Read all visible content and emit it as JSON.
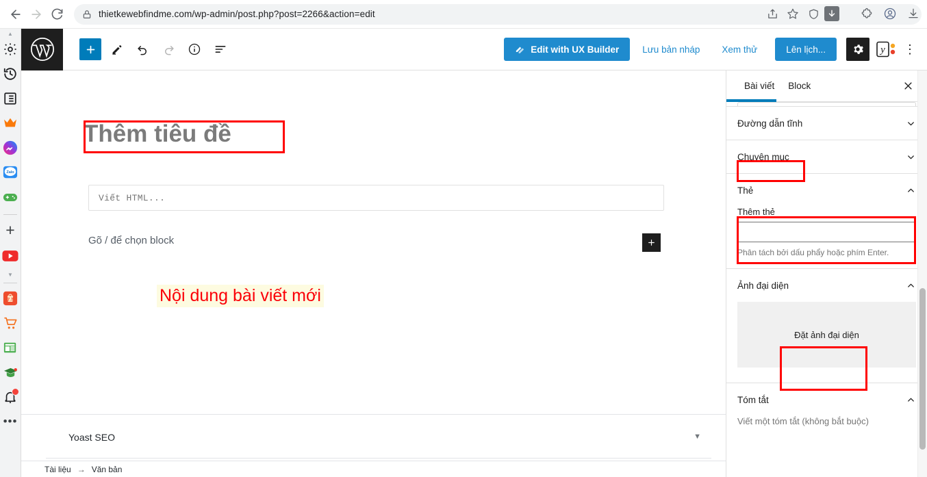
{
  "browser": {
    "url": "thietkewebfindme.com/wp-admin/post.php?post=2266&action=edit",
    "nav": {
      "back": "back-arrow",
      "forward": "forward-arrow",
      "reload": "reload"
    },
    "omnibox_icons": [
      "share-icon",
      "bookmark-star-icon",
      "shield-icon",
      "download-arrow-icon"
    ],
    "extension_icons": [
      "puzzle-extensions-icon",
      "profile-avatar-icon",
      "downloads-icon"
    ]
  },
  "left_rail": {
    "items": [
      {
        "name": "collapse-caret",
        "glyph": "caret"
      },
      {
        "name": "settings-gear-icon",
        "glyph": "gear"
      },
      {
        "name": "history-icon",
        "glyph": "history"
      },
      {
        "name": "list-icon",
        "glyph": "list"
      },
      {
        "name": "crown-icon",
        "glyph": "crown"
      },
      {
        "name": "messenger-icon",
        "glyph": "messenger"
      },
      {
        "name": "zalo-icon",
        "glyph": "zalo",
        "label": "Zalo"
      },
      {
        "name": "gamepad-icon",
        "glyph": "gamepad"
      },
      {
        "name": "add-app-icon",
        "glyph": "plus"
      },
      {
        "name": "youtube-icon",
        "glyph": "youtube"
      },
      {
        "name": "more-caret",
        "glyph": "caret-down"
      },
      {
        "name": "shopee-icon",
        "glyph": "shopee",
        "label": "7.7"
      },
      {
        "name": "cart-icon",
        "glyph": "cart"
      },
      {
        "name": "news-icon",
        "glyph": "news"
      },
      {
        "name": "graduation-icon",
        "glyph": "graduation"
      },
      {
        "name": "notification-bell-icon",
        "glyph": "bell",
        "badge": true
      },
      {
        "name": "overflow-menu-icon",
        "glyph": "dots"
      }
    ]
  },
  "wp_header": {
    "logo": "wordpress-logo",
    "tools": [
      {
        "name": "add-block-button",
        "glyph": "plus",
        "style": "primary"
      },
      {
        "name": "edit-tool-button",
        "glyph": "pencil"
      },
      {
        "name": "undo-button",
        "glyph": "undo"
      },
      {
        "name": "redo-button",
        "glyph": "redo",
        "style": "dim"
      },
      {
        "name": "details-info-button",
        "glyph": "info"
      },
      {
        "name": "list-view-button",
        "glyph": "list-view"
      }
    ],
    "ux_builder_label": "Edit with UX Builder",
    "save_draft_label": "Lưu bản nháp",
    "preview_label": "Xem thử",
    "schedule_label": "Lên lịch...",
    "settings_icon": "gear-icon",
    "yoast_icon": "yoast-seo-icon",
    "more_icon": "kebab-menu-icon",
    "accent_blue": "#1f8bce",
    "wp_blue": "#007cba"
  },
  "editor": {
    "title_placeholder": "Thêm tiêu đề",
    "html_block_placeholder": "Viết HTML...",
    "block_prompt": "Gõ / để chọn block",
    "inserter_icon": "plus-icon",
    "annotation_note": "Nội dung bài viết mới",
    "yoast_metabox_title": "Yoast SEO",
    "yoast_toggle_icon": "caret-down-icon",
    "breadcrumb": {
      "document": "Tài liệu",
      "arrow": "→",
      "current": "Văn bản"
    }
  },
  "sidebar": {
    "tabs": [
      {
        "name": "tab-post",
        "label": "Bài viết",
        "active": true
      },
      {
        "name": "tab-block",
        "label": "Block",
        "active": false
      }
    ],
    "close_icon": "close-icon",
    "panels": [
      {
        "name": "permalink-panel",
        "title": "Đường dẫn tĩnh",
        "state": "collapsed",
        "chevron": "chevron-down-icon"
      },
      {
        "name": "categories-panel",
        "title": "Chuyên mục",
        "state": "collapsed",
        "chevron": "chevron-down-icon",
        "highlighted": true
      },
      {
        "name": "tags-panel",
        "title": "Thẻ",
        "state": "expanded",
        "chevron": "chevron-up-icon"
      },
      {
        "name": "featured-image-panel",
        "title": "Ảnh đại diện",
        "state": "expanded",
        "chevron": "chevron-up-icon"
      },
      {
        "name": "excerpt-panel",
        "title": "Tóm tắt",
        "state": "expanded",
        "chevron": "chevron-up-icon"
      }
    ],
    "tags": {
      "field_label": "Thêm thẻ",
      "input_value": "",
      "help_text": "Phân tách bởi dấu phẩy hoặc phím Enter."
    },
    "featured_image": {
      "button_label": "Đặt ảnh đại diện"
    },
    "excerpt": {
      "cut_text": "Viết một tóm tắt (không bắt buộc)"
    }
  },
  "annotations": {
    "highlight_color": "#ff0000",
    "note_background": "#fdfbe0"
  }
}
